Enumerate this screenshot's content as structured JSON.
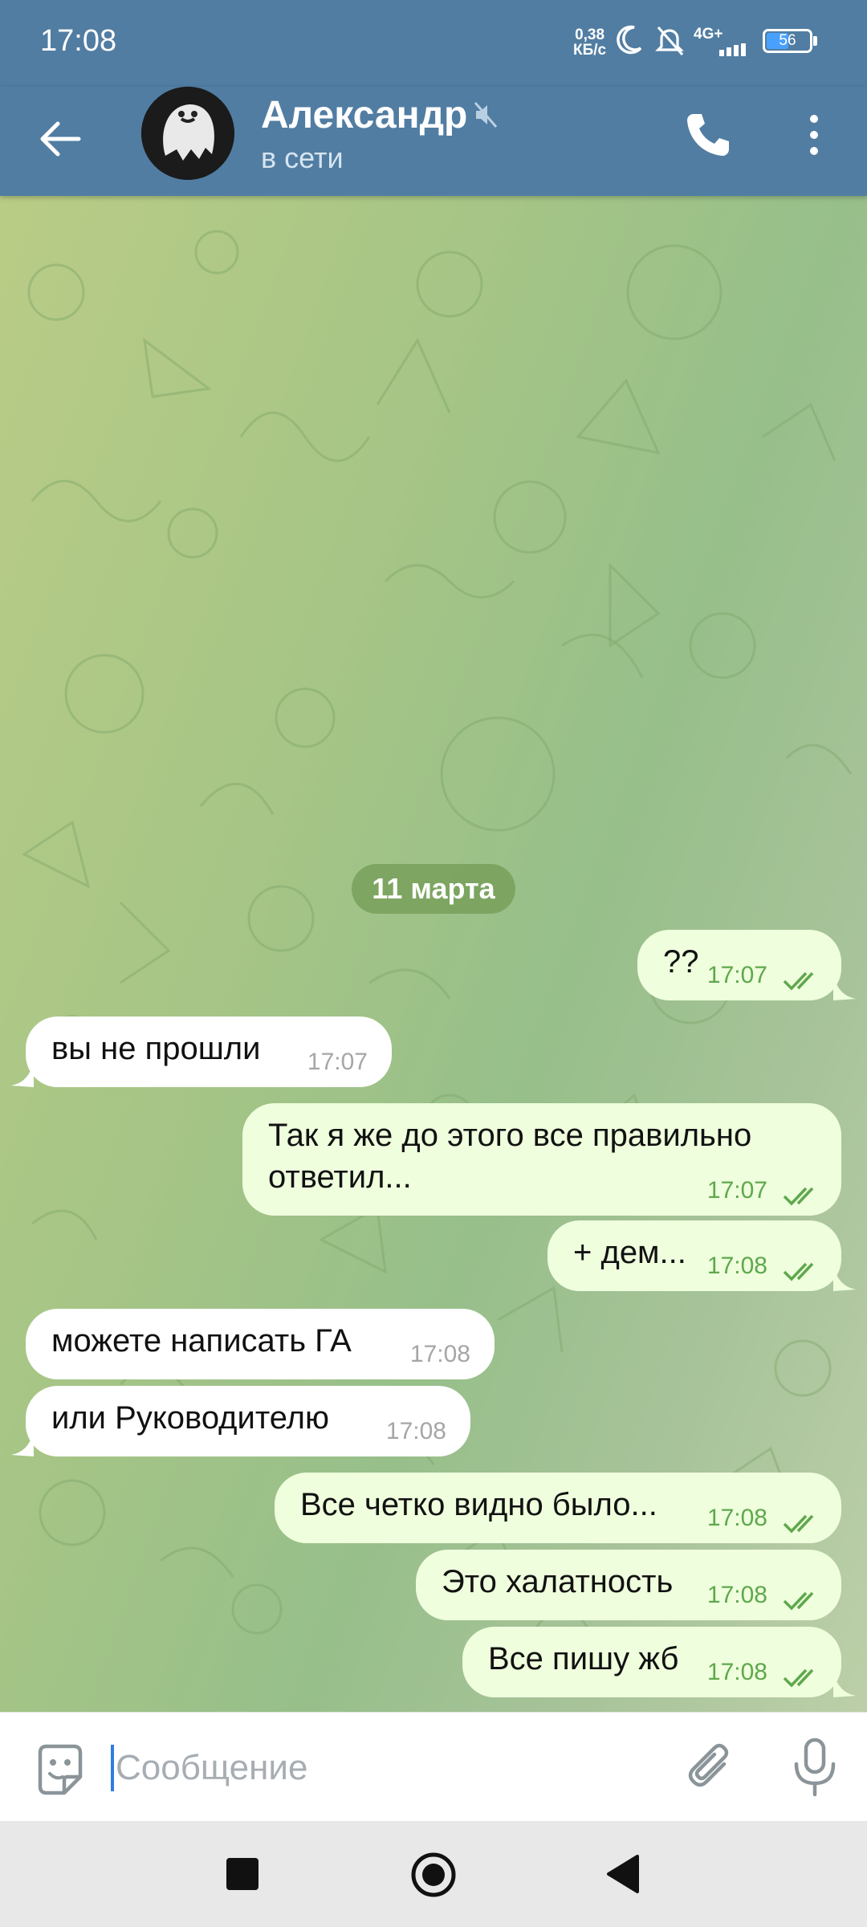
{
  "status_bar": {
    "time": "17:08",
    "net_speed_value": "0,38",
    "net_speed_unit": "КБ/с",
    "network": "4G+",
    "battery": "56",
    "battery_level_percent": 56,
    "icons": [
      "moon-icon",
      "bell-off-icon",
      "signal-icon",
      "battery-icon"
    ]
  },
  "header": {
    "name": "Александр",
    "status": "в сети",
    "icons": [
      "back-arrow-icon",
      "mute-icon",
      "phone-icon",
      "more-vert-icon"
    ]
  },
  "chat": {
    "date": "11 марта",
    "messages": [
      {
        "direction": "out",
        "text": "??",
        "time": "17:07",
        "status": "read"
      },
      {
        "direction": "in",
        "text": "вы не прошли",
        "time": "17:07"
      },
      {
        "direction": "out",
        "text_line1": "Так я же до этого все правильно",
        "text_line2": "ответил...",
        "time": "17:07",
        "status": "read"
      },
      {
        "direction": "out",
        "text": "+ дем...",
        "time": "17:08",
        "status": "read"
      },
      {
        "direction": "in",
        "text": "можете написать ГА",
        "time": "17:08"
      },
      {
        "direction": "in",
        "text": "или Руководителю",
        "time": "17:08"
      },
      {
        "direction": "out",
        "text": "Все четко видно было...",
        "time": "17:08",
        "status": "read"
      },
      {
        "direction": "out",
        "text": "Это халатность",
        "time": "17:08",
        "status": "read"
      },
      {
        "direction": "out",
        "text": "Все пишу жб",
        "time": "17:08",
        "status": "read"
      }
    ]
  },
  "input": {
    "placeholder": "Сообщение",
    "value": "",
    "icons": [
      "emoji-icon",
      "paperclip-icon",
      "microphone-icon"
    ]
  },
  "nav": {
    "icons": [
      "recents-square-icon",
      "home-circle-icon",
      "back-triangle-icon"
    ]
  },
  "colors": {
    "header": "#517da2",
    "outgoing_bubble": "#effedd",
    "incoming_bubble": "#ffffff",
    "read_ticks": "#5fa84d",
    "date_chip": "#78a05a"
  }
}
